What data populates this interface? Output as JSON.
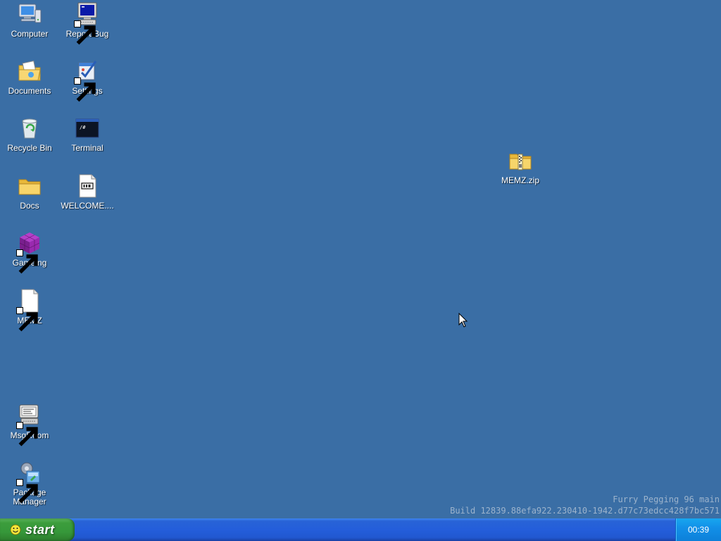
{
  "desktop": {
    "background_color": "#3a6ea5",
    "icons": {
      "computer": {
        "label": "Computer",
        "icon": "computer-icon"
      },
      "report_bug": {
        "label": "Report Bug",
        "icon": "monitor-icon"
      },
      "documents": {
        "label": "Documents",
        "icon": "documents-folder-icon"
      },
      "settings": {
        "label": "Settings",
        "icon": "settings-icon"
      },
      "recycle_bin": {
        "label": "Recycle Bin",
        "icon": "recycle-bin-icon"
      },
      "terminal": {
        "label": "Terminal",
        "icon": "terminal-icon"
      },
      "docs": {
        "label": "Docs",
        "icon": "folder-icon"
      },
      "welcome": {
        "label": "WELCOME....",
        "icon": "text-file-icon"
      },
      "gameing": {
        "label": "Gameing",
        "icon": "cube-icon"
      },
      "memz": {
        "label": "MEMZ",
        "icon": "blank-file-icon"
      },
      "msgroom": {
        "label": "MsgRoom",
        "icon": "chat-terminal-icon"
      },
      "package_manager": {
        "label": "Package Manager",
        "icon": "package-icon"
      },
      "memz_zip": {
        "label": "MEMZ.zip",
        "icon": "zip-folder-icon"
      }
    },
    "build_info": {
      "line1": "Furry Pegging 96 main",
      "line2": "Build 12839.88efa922.230410-1942.d77c73edcc428f7bc571"
    }
  },
  "taskbar": {
    "start_label": "start",
    "clock": "00:39",
    "colors": {
      "taskbar": "#245edb",
      "start": "#36983a",
      "tray": "#1290e8"
    }
  }
}
